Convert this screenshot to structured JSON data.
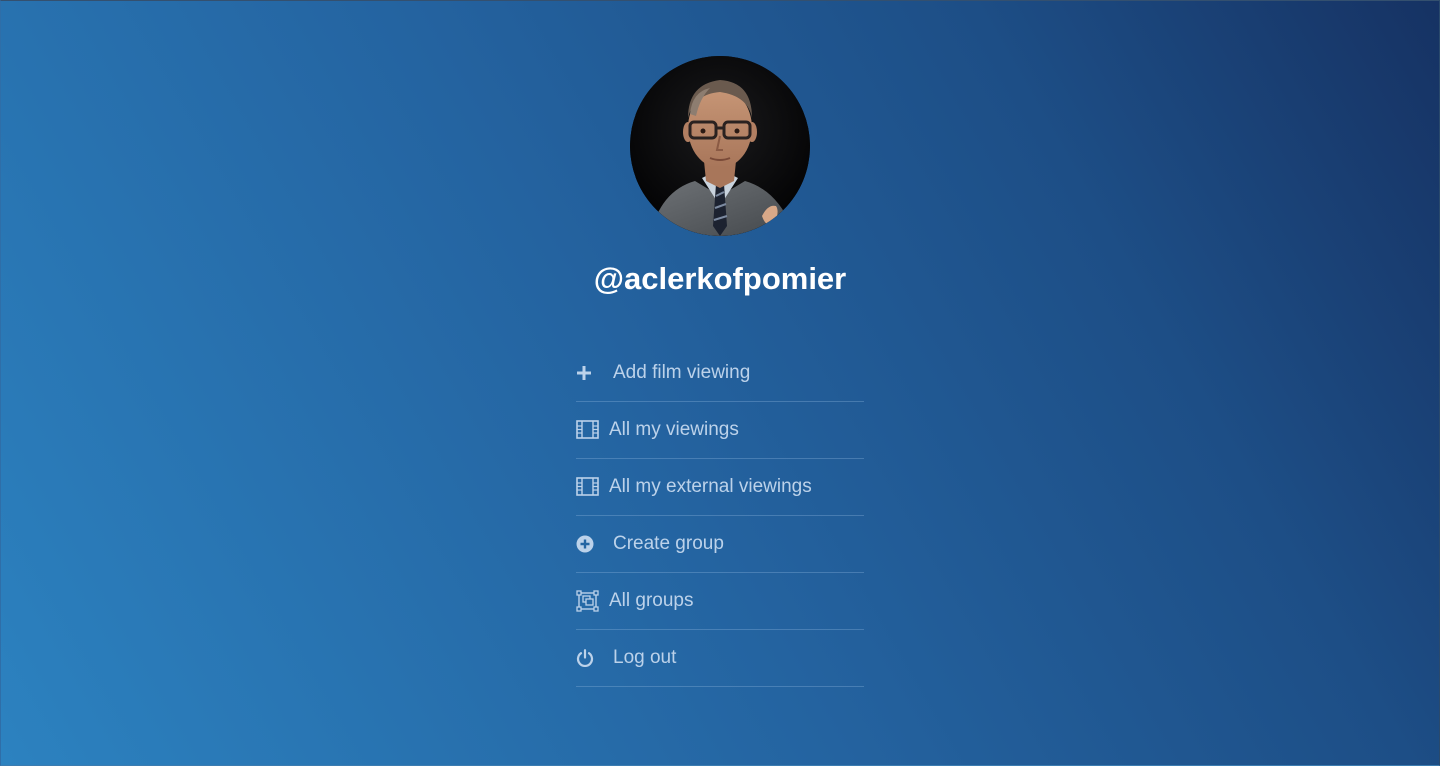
{
  "profile": {
    "username": "@aclerkofpomier",
    "avatar_icon": "user-photo"
  },
  "menu": {
    "items": [
      {
        "label": "Add film viewing",
        "icon": "plus-icon"
      },
      {
        "label": "All my viewings",
        "icon": "film-icon"
      },
      {
        "label": "All my external viewings",
        "icon": "film-icon"
      },
      {
        "label": "Create group",
        "icon": "plus-circle-icon"
      },
      {
        "label": "All groups",
        "icon": "group-icon"
      },
      {
        "label": "Log out",
        "icon": "power-icon"
      }
    ]
  },
  "colors": {
    "background_start": "#2c82c0",
    "background_end": "#163263",
    "menu_text": "#bcd2ea",
    "username_text": "#ffffff"
  }
}
